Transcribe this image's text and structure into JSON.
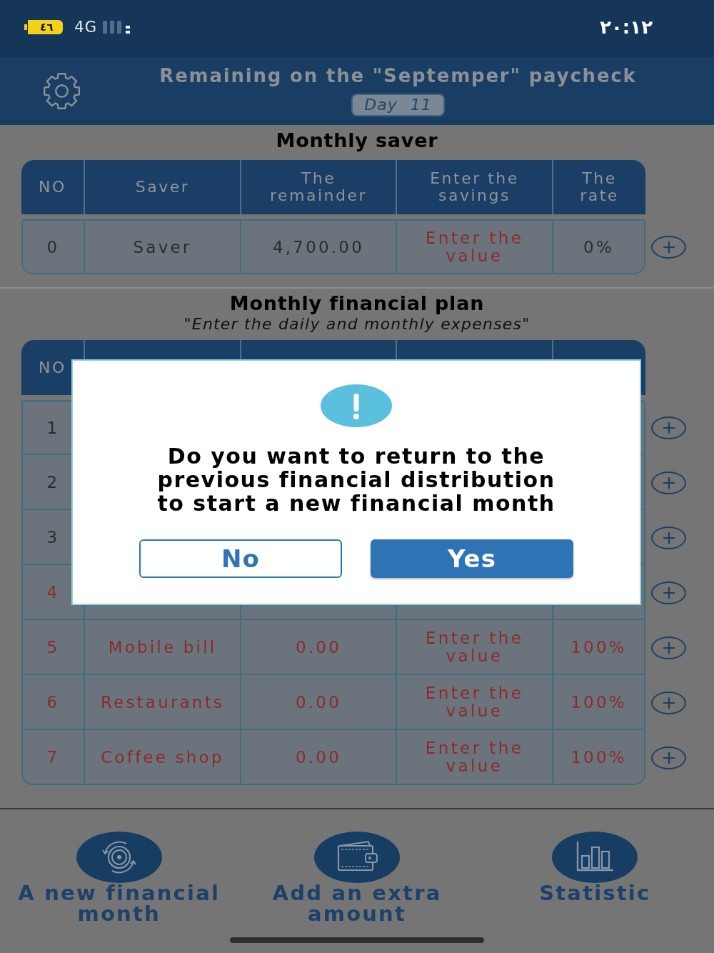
{
  "status_bar": {
    "battery": "٤٦",
    "network": "4G",
    "time": "٢٠:١٢"
  },
  "header": {
    "title": "Remaining on the \"Septemper\" paycheck",
    "day": "Day 11"
  },
  "saver_table": {
    "title": "Monthly saver",
    "columns": [
      "NO",
      "Saver",
      "The remainder",
      "Enter the savings",
      "The rate"
    ],
    "rows": [
      {
        "no": "0",
        "name": "Saver",
        "remainder": "4,700.00",
        "placeholder": "Enter the value",
        "rate": "0%",
        "alert": false
      }
    ]
  },
  "plan_table": {
    "title": "Monthly financial plan",
    "subtitle": "\"Enter the daily and monthly expenses\"",
    "columns": [
      "NO"
    ],
    "rows": [
      {
        "no": "1",
        "alert": false
      },
      {
        "no": "2",
        "alert": false
      },
      {
        "no": "3",
        "alert": false
      },
      {
        "no": "4",
        "alert": true
      },
      {
        "no": "5",
        "name": "Mobile bill",
        "remainder": "0.00",
        "placeholder": "Enter the value",
        "rate": "100%",
        "alert": true
      },
      {
        "no": "6",
        "name": "Restaurants",
        "remainder": "0.00",
        "placeholder": "Enter the value",
        "rate": "100%",
        "alert": true
      },
      {
        "no": "7",
        "name": "Coffee shop",
        "remainder": "0.00",
        "placeholder": "Enter the value",
        "rate": "100%",
        "alert": true
      }
    ]
  },
  "dialog": {
    "message": "Do you want to return to the previous financial distribution to start a new financial month",
    "buttons": [
      {
        "label": "No",
        "kind": "outline"
      },
      {
        "label": "Yes",
        "kind": "filled"
      }
    ]
  },
  "bottom_nav": [
    {
      "label": "A new financial month"
    },
    {
      "label": "Add an extra amount"
    },
    {
      "label": "Statistic"
    }
  ]
}
